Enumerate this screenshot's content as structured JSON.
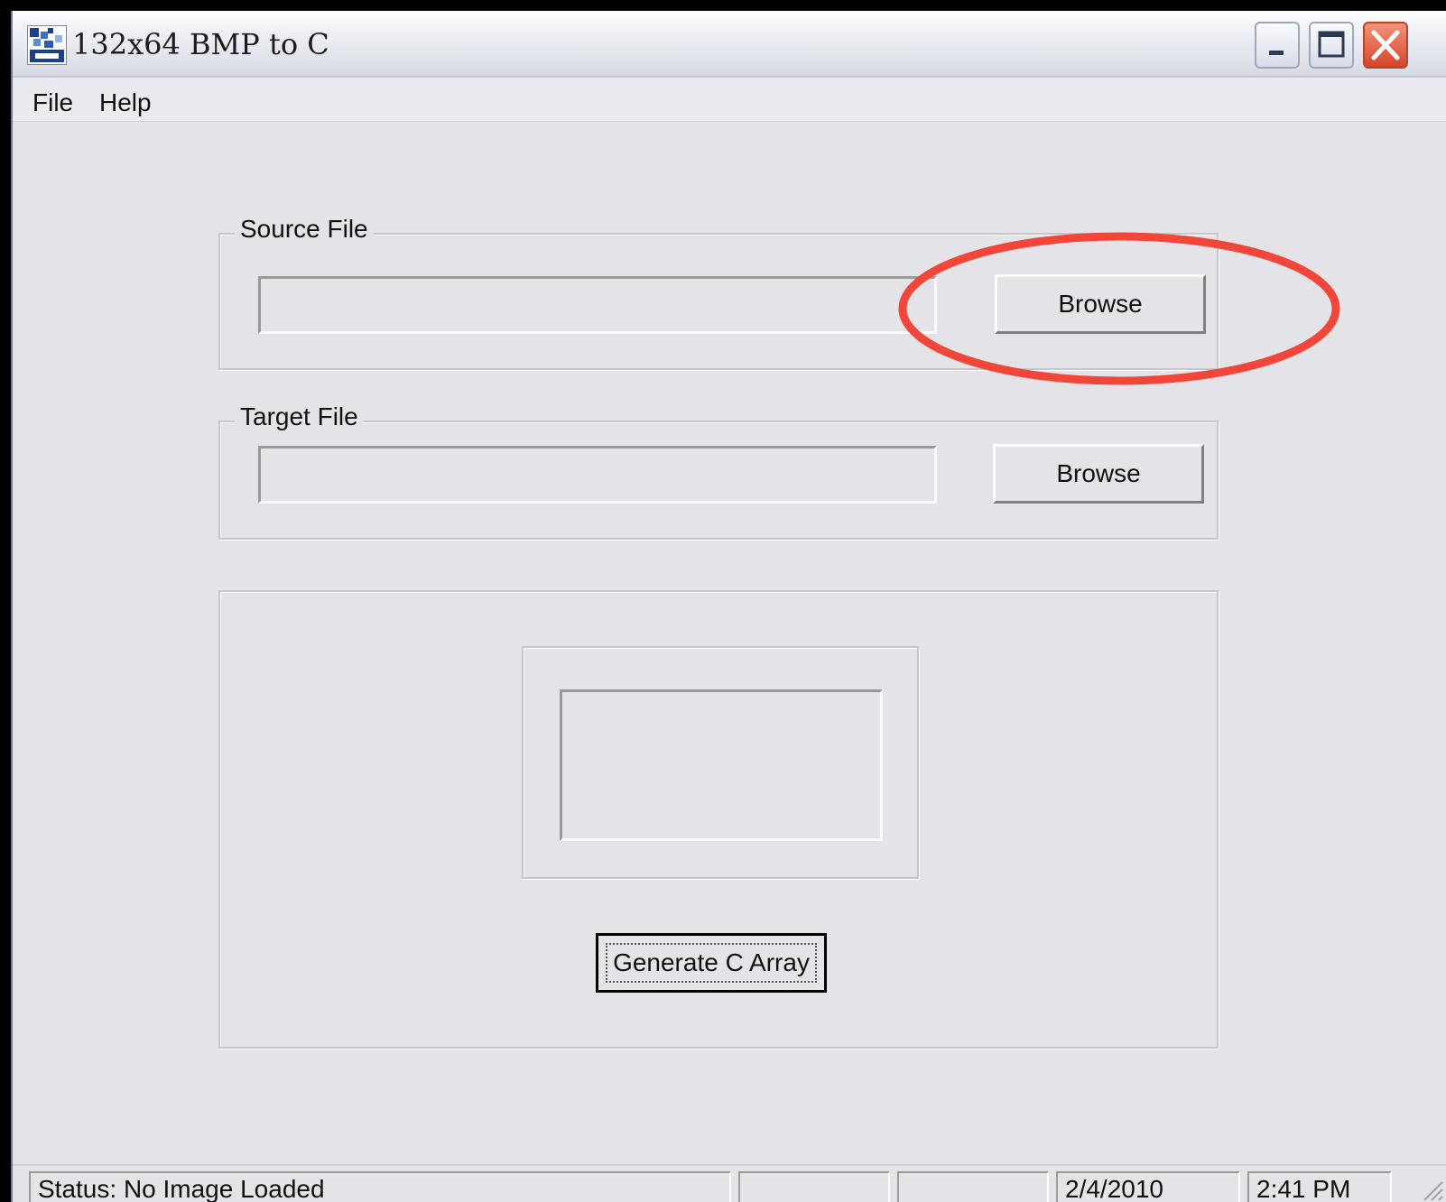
{
  "window": {
    "title": "132x64 BMP to C"
  },
  "menu": {
    "file": "File",
    "help": "Help"
  },
  "source_group": {
    "label": "Source File",
    "path_value": "",
    "browse_label": "Browse"
  },
  "target_group": {
    "label": "Target File",
    "path_value": "",
    "browse_label": "Browse"
  },
  "actions": {
    "generate_label": "Generate C Array"
  },
  "status": {
    "text": "Status:  No Image Loaded",
    "date": "2/4/2010",
    "time": "2:41 PM"
  },
  "colors": {
    "annotation": "#f0473a",
    "window_bg": "#e4e3e8",
    "close_button": "#d6452a"
  }
}
